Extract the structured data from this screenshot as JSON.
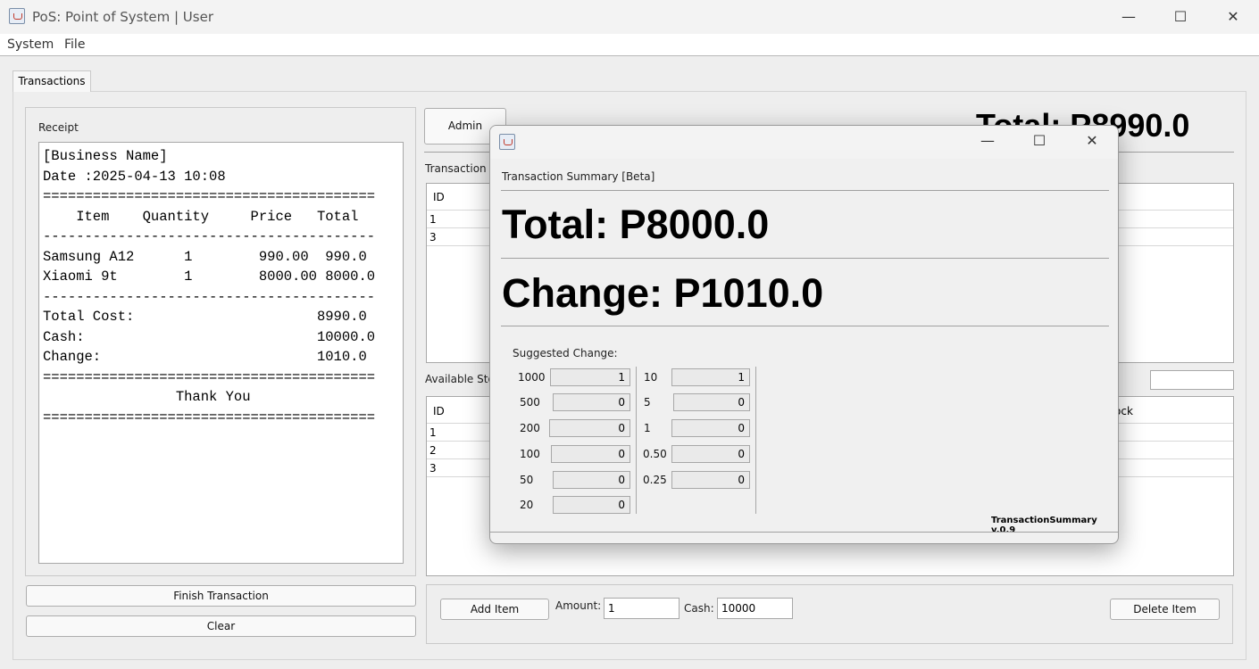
{
  "window": {
    "title": "PoS: Point of System | User",
    "minimize": "—",
    "maximize": "☐",
    "close": "✕"
  },
  "menu": [
    "System",
    "File"
  ],
  "tab": "Transactions",
  "receipt": {
    "label": "Receipt",
    "lines": [
      "[Business Name]",
      "Date :2025-04-13 10:08",
      "========================================",
      "    Item    Quantity     Price   Total",
      "----------------------------------------",
      "Samsung A12      1        990.00  990.0",
      "Xiaomi 9t        1        8000.00 8000.0",
      "----------------------------------------",
      "Total Cost:                      8990.0",
      "Cash:                            10000.0",
      "Change:                          1010.0",
      "========================================",
      "                Thank You",
      "========================================"
    ]
  },
  "buttons": {
    "finish": "Finish Transaction",
    "clear": "Clear",
    "admin": "Admin",
    "add_item": "Add Item",
    "delete_item": "Delete Item"
  },
  "main": {
    "total": "Total: P8990.0",
    "transaction_items_label": "Transaction I",
    "transaction_header_id": "ID",
    "transaction_rows": [
      "1",
      "3"
    ],
    "available_stock_label": "Available Sto",
    "stock_header_id": "ID",
    "stock_header_stock": "ock",
    "stock_rows": [
      "1",
      "2",
      "3"
    ],
    "search_value": ""
  },
  "form": {
    "amount_label": "Amount:",
    "amount_value": "1",
    "cash_label": "Cash:",
    "cash_value": "10000"
  },
  "dialog": {
    "heading": "Transaction Summary [Beta]",
    "total": "Total: P8000.0",
    "change": "Change: P1010.0",
    "suggested_label": "Suggested Change:",
    "left": [
      {
        "denom": "1000",
        "count": "1"
      },
      {
        "denom": "500",
        "count": "0"
      },
      {
        "denom": "200",
        "count": "0"
      },
      {
        "denom": "100",
        "count": "0"
      },
      {
        "denom": "50",
        "count": "0"
      },
      {
        "denom": "20",
        "count": "0"
      }
    ],
    "right": [
      {
        "denom": "10",
        "count": "1"
      },
      {
        "denom": "5",
        "count": "0"
      },
      {
        "denom": "1",
        "count": "0"
      },
      {
        "denom": "0.50",
        "count": "0"
      },
      {
        "denom": "0.25",
        "count": "0"
      }
    ],
    "version": "TransactionSummary v.0.9"
  }
}
